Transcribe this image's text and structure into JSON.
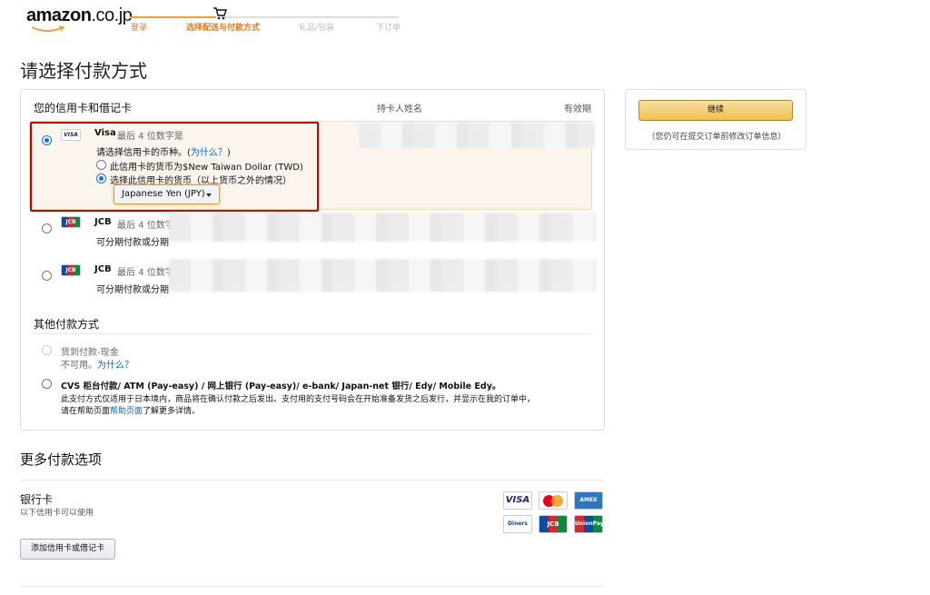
{
  "header": {
    "logo": {
      "name": "amazon",
      "tld": ".co.jp"
    },
    "steps": [
      "登录",
      "选择配送与付款方式",
      "礼品/包装",
      "下订单"
    ]
  },
  "page_title": "请选择付款方式",
  "cards_section": {
    "title": "您的信用卡和借记卡",
    "col_holder": "持卡人姓名",
    "col_expiry": "有效期",
    "selected_card": {
      "brand": "Visa",
      "suffix": "最后 4 位数字是",
      "currency_prompt": "请选择信用卡的币种。(",
      "why_link": "为什么？",
      "currency_prompt_end": ")",
      "option_card_currency": "此信用卡的货币为$New Taiwan Dollar (TWD)",
      "option_other_currency": "选择此信用卡的货币（以上货币之外的情况）",
      "currency_select": "Japanese Yen (JPY)"
    },
    "other_cards": [
      {
        "brand": "JCB",
        "suffix": "最后 4 位数字",
        "note": "可分期付款或分期"
      },
      {
        "brand": "JCB",
        "suffix": "最后 4 位数字",
        "note": "可分期付款或分期"
      }
    ]
  },
  "other_section": {
    "title": "其他付款方式",
    "cod": {
      "label": "货到付款-现金",
      "unavailable": "不可用。",
      "why_link": "为什么？"
    },
    "cvs": {
      "label": "CVS 柜台付款/ ATM (Pay-easy) / 网上银行 (Pay-easy)/ e-bank/ Japan-net 银行/ Edy/ Mobile Edy。",
      "desc": "此支付方式仅适用于日本境内，商品将在确认付款之后发出。支付用的支付号码会在开始准备发货之后发行，并显示在我的订单中，",
      "help_prefix": "请在帮助页面",
      "help_link": "帮助页面",
      "help_suffix": "了解更多详情。"
    }
  },
  "side": {
    "continue": "继续",
    "note": "（您仍可在提交订单前修改订单信息）"
  },
  "more": {
    "title": "更多付款选项",
    "bank_title": "银行卡",
    "bank_sub": "以下信用卡可以使用",
    "add_button": "添加信用卡或借记卡",
    "brands": [
      "VISA",
      "MasterCard",
      "AMERICAN EXPRESS",
      "Diners Club International",
      "JCB",
      "UnionPay 银联"
    ]
  },
  "colors": {
    "accent": "#e47911",
    "link": "#0066c0",
    "highlight": "#c40000",
    "button": "#f0c14b"
  }
}
